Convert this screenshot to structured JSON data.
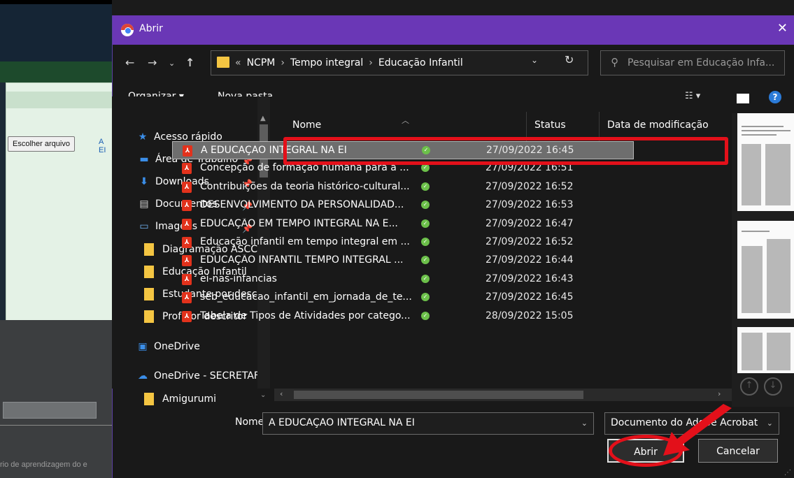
{
  "background_page": {
    "file_button": "Escolher arquivo",
    "file_link": "A EI",
    "bottom_text": "rio de aprendizagem do e"
  },
  "dialog": {
    "title": "Abrir",
    "close": "✕",
    "path": [
      "NCPM",
      "Tempo integral",
      "Educação Infantil"
    ],
    "search_placeholder": "Pesquisar em Educação Infa...",
    "toolbar": {
      "organize": "Organizar ▾",
      "new_folder": "Nova pasta",
      "help": "?"
    },
    "nav_pane": {
      "quick_access": "Acesso rápido",
      "items": [
        {
          "label": "Área de Trabalho",
          "icon": "desktop-icon",
          "pinned": true
        },
        {
          "label": "Downloads",
          "icon": "download-icon",
          "pinned": true
        },
        {
          "label": "Documentos",
          "icon": "documents-icon",
          "pinned": true
        },
        {
          "label": "Imagens",
          "icon": "pictures-icon",
          "pinned": true
        },
        {
          "label": "Diagramação ASCC",
          "icon": "folder-icon",
          "pinned": false
        },
        {
          "label": "Educação Infantil",
          "icon": "folder-icon",
          "pinned": false
        },
        {
          "label": "Estudante por descr",
          "icon": "folder-icon",
          "pinned": false
        },
        {
          "label": "Prof por descritor",
          "icon": "folder-icon",
          "pinned": false
        }
      ],
      "onedrive": "OneDrive",
      "onedrive_org": "OneDrive - SECRETAF",
      "amigurumi": "Amigurumi"
    },
    "columns": {
      "name": "Nome",
      "status": "Status",
      "date": "Data de modificação"
    },
    "files": [
      {
        "name": "A EDUCAÇAO INTEGRAL NA EI",
        "date": "27/09/2022 16:45",
        "selected": true
      },
      {
        "name": "Concepção de formação humana para a ...",
        "date": "27/09/2022 16:51",
        "selected": false
      },
      {
        "name": "Contribuições da teoria histórico-cultural...",
        "date": "27/09/2022 16:52",
        "selected": false
      },
      {
        "name": "DESENVOLVIMENTO DA PERSONALIDAD...",
        "date": "27/09/2022 16:53",
        "selected": false
      },
      {
        "name": "EDUCAÇÃO EM TEMPO INTEGRAL NA E...",
        "date": "27/09/2022 16:47",
        "selected": false
      },
      {
        "name": "Educação infantil em tempo integral em ...",
        "date": "27/09/2022 16:52",
        "selected": false
      },
      {
        "name": "EDUCAÇÃO INFANTIL TEMPO INTEGRAL ...",
        "date": "27/09/2022 16:44",
        "selected": false
      },
      {
        "name": "ei-nas-infancias",
        "date": "27/09/2022 16:43",
        "selected": false
      },
      {
        "name": "seb_educacao_infantil_em_jornada_de_te...",
        "date": "27/09/2022 16:45",
        "selected": false
      },
      {
        "name": "Tabela de Tipos de Atividades por catego...",
        "date": "28/09/2022 15:05",
        "selected": false
      }
    ],
    "filename_label": "Nome:",
    "filename_value": "A EDUCAÇAO INTEGRAL NA EI",
    "filetype": "Documento do Adobe Acrobat",
    "open_button": "Abrir",
    "cancel_button": "Cancelar"
  },
  "colors": {
    "titlebar": "#6a37b6",
    "dialog_bg": "#191919",
    "selection": "#6e6e6e",
    "highlight_annotation": "#e3101a",
    "pdf_icon": "#e2321c",
    "status_ok": "#6cc04a"
  }
}
